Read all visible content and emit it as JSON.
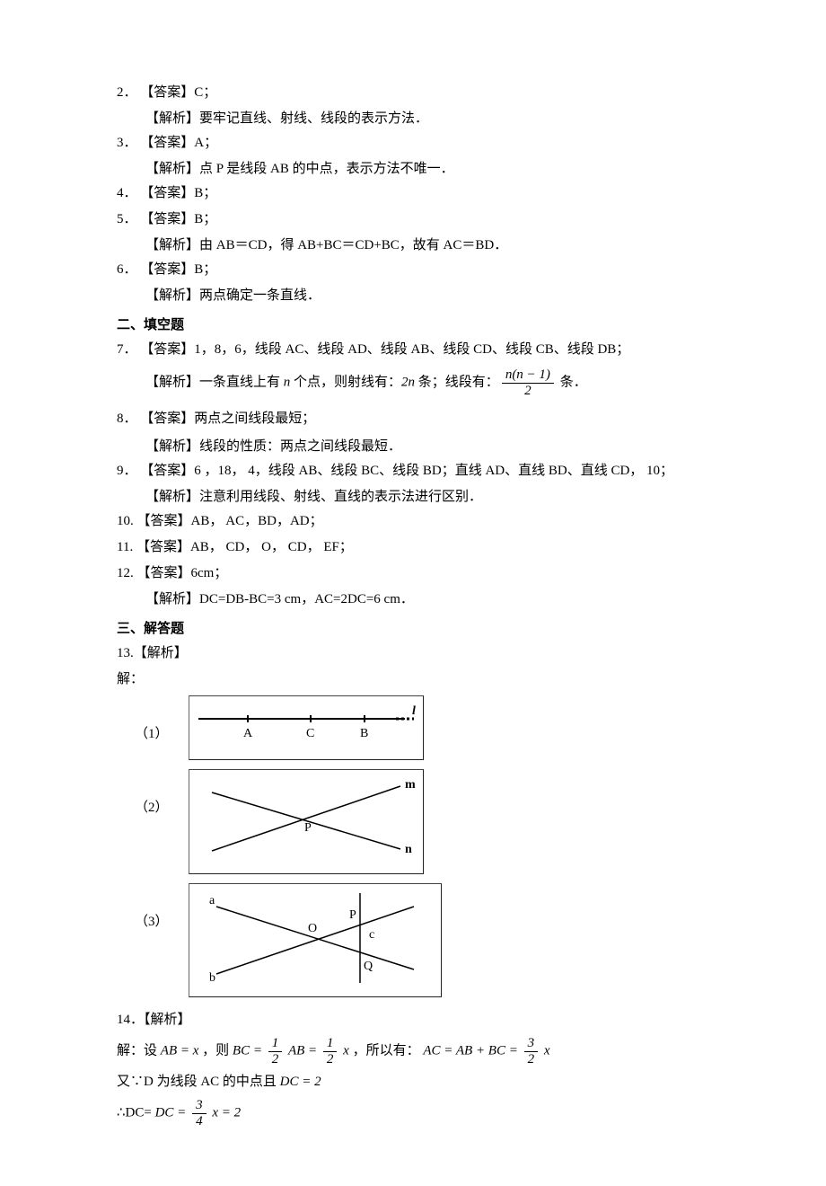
{
  "items": [
    {
      "num": "2．",
      "ans_label": "【答案】",
      "ans": "C；",
      "expl_label": "【解析】",
      "expl": "要牢记直线、射线、线段的表示方法．"
    },
    {
      "num": "3．",
      "ans_label": "【答案】",
      "ans": "A；",
      "expl_label": "【解析】",
      "expl": "点 P 是线段 AB 的中点，表示方法不唯一．"
    },
    {
      "num": "4．",
      "ans_label": "【答案】",
      "ans": "B；",
      "expl_label": "",
      "expl": ""
    },
    {
      "num": "5．",
      "ans_label": "【答案】",
      "ans": "B；",
      "expl_label": "【解析】",
      "expl": "由 AB＝CD，得 AB+BC＝CD+BC，故有 AC＝BD．"
    },
    {
      "num": "6．",
      "ans_label": "【答案】",
      "ans": "B；",
      "expl_label": "【解析】",
      "expl": "两点确定一条直线．"
    }
  ],
  "section2": "二、填空题",
  "fill": [
    {
      "num": "7．",
      "ans_label": "【答案】",
      "ans": "1，8，6，线段 AC、线段 AD、线段 AB、线段 CD、线段 CB、线段 DB；",
      "expl_label": "【解析】",
      "expl_prefix": "一条直线上有 ",
      "expl_mid1": " 个点，则射线有：",
      "expl_mid2": " 条；线段有：",
      "expl_suffix": " 条．",
      "n": "n",
      "rays": "2n",
      "frac_top": "n(n − 1)",
      "frac_bot": "2"
    },
    {
      "num": "8．",
      "ans_label": "【答案】",
      "ans": "两点之间线段最短；",
      "expl_label": "【解析】",
      "expl": "线段的性质：两点之间线段最短．"
    },
    {
      "num": "9．",
      "ans_label": "【答案】",
      "ans": "6 ，18， 4，线段 AB、线段 BC、线段 BD；直线 AD、直线 BD、直线 CD，  10；",
      "expl_label": "【解析】",
      "expl": "注意利用线段、射线、直线的表示法进行区别．"
    },
    {
      "num": "10.",
      "ans_label": "【答案】",
      "ans": "AB， AC，BD，AD；",
      "expl_label": "",
      "expl": ""
    },
    {
      "num": "11.",
      "ans_label": "【答案】",
      "ans": "AB，  CD，  O，  CD，  EF；",
      "expl_label": "",
      "expl": ""
    },
    {
      "num": "12.",
      "ans_label": "【答案】",
      "ans": "6cm；",
      "expl_label": "【解析】",
      "expl": "DC=DB-BC=3 cm，AC=2DC=6 cm．"
    }
  ],
  "section3": "三、解答题",
  "q13": {
    "num": "13.",
    "label": "【解析】",
    "jie": "解：",
    "f1": "（1）",
    "f2": "（2）",
    "f3": "（3）"
  },
  "fig1_labels": {
    "A": "A",
    "C": "C",
    "B": "B",
    "l": "l"
  },
  "fig2_labels": {
    "P": "P",
    "m": "m",
    "n": "n"
  },
  "fig3_labels": {
    "a": "a",
    "b": "b",
    "c": "c",
    "O": "O",
    "P": "P",
    "Q": "Q"
  },
  "q14": {
    "num": "14．",
    "label": "【解析】",
    "jie": "解：",
    "line1_a": "设 ",
    "line1_b": "AB = x",
    "line1_c": " ，则 ",
    "bc_eq": "BC =",
    "ab_half": "AB =",
    "x_half": "x",
    "so": "，所以有：",
    "ac_eq": "AC = AB + BC =",
    "x3": "x",
    "line2_a": "又∵D 为线段 AC 的中点且 ",
    "dc2": "DC = 2",
    "line3_a": "∴DC= ",
    "dc_eq": "DC =",
    "eq2": "x = 2",
    "half_top": "1",
    "half_bot": "2",
    "threehalf_top": "3",
    "threehalf_bot": "2",
    "threequarter_top": "3",
    "threequarter_bot": "4"
  }
}
